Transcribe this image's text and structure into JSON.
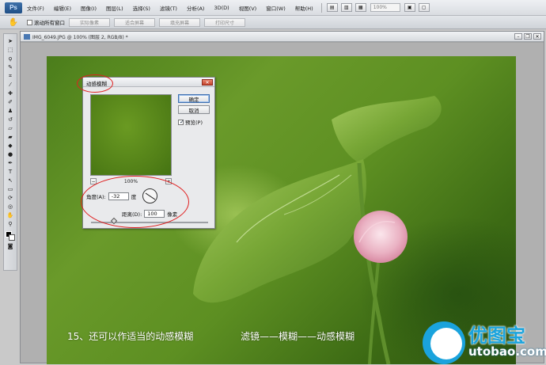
{
  "menubar": {
    "logo": "Ps",
    "items": [
      "文件(F)",
      "编辑(E)",
      "图像(I)",
      "图层(L)",
      "选择(S)",
      "滤镜(T)",
      "分析(A)",
      "3D(D)",
      "视图(V)",
      "窗口(W)",
      "帮助(H)"
    ],
    "zoom_value": "100%"
  },
  "optionsbar": {
    "tool_icon": "hand-tool-icon",
    "scroll_all_label": "滚动所有窗口",
    "buttons": [
      "实际像素",
      "适合屏幕",
      "填充屏幕",
      "打印尺寸"
    ]
  },
  "document": {
    "tab_title": "IMG_6049.JPG @ 100% (图层 2, RGB/8) *"
  },
  "dialog": {
    "title": "动感模糊",
    "ok_label": "确定",
    "cancel_label": "取消",
    "preview_label": "预览(P)",
    "preview_checked": true,
    "zoom_minus": "−",
    "zoom_plus": "+",
    "zoom_percent": "100%",
    "angle_label": "角度(A):",
    "angle_value": "-32",
    "angle_unit": "度",
    "distance_label": "距离(D):",
    "distance_value": "100",
    "distance_unit": "像素"
  },
  "captions": {
    "left": "15、还可以作适当的动感模糊",
    "right": "滤镜——模糊——动感模糊"
  },
  "watermark": {
    "title": "优图宝",
    "url": "utobao.com"
  },
  "colors": {
    "annotation_red": "#e02020",
    "watermark_blue": "#1aa3dd",
    "leaf_green": "#6a9a2a"
  }
}
